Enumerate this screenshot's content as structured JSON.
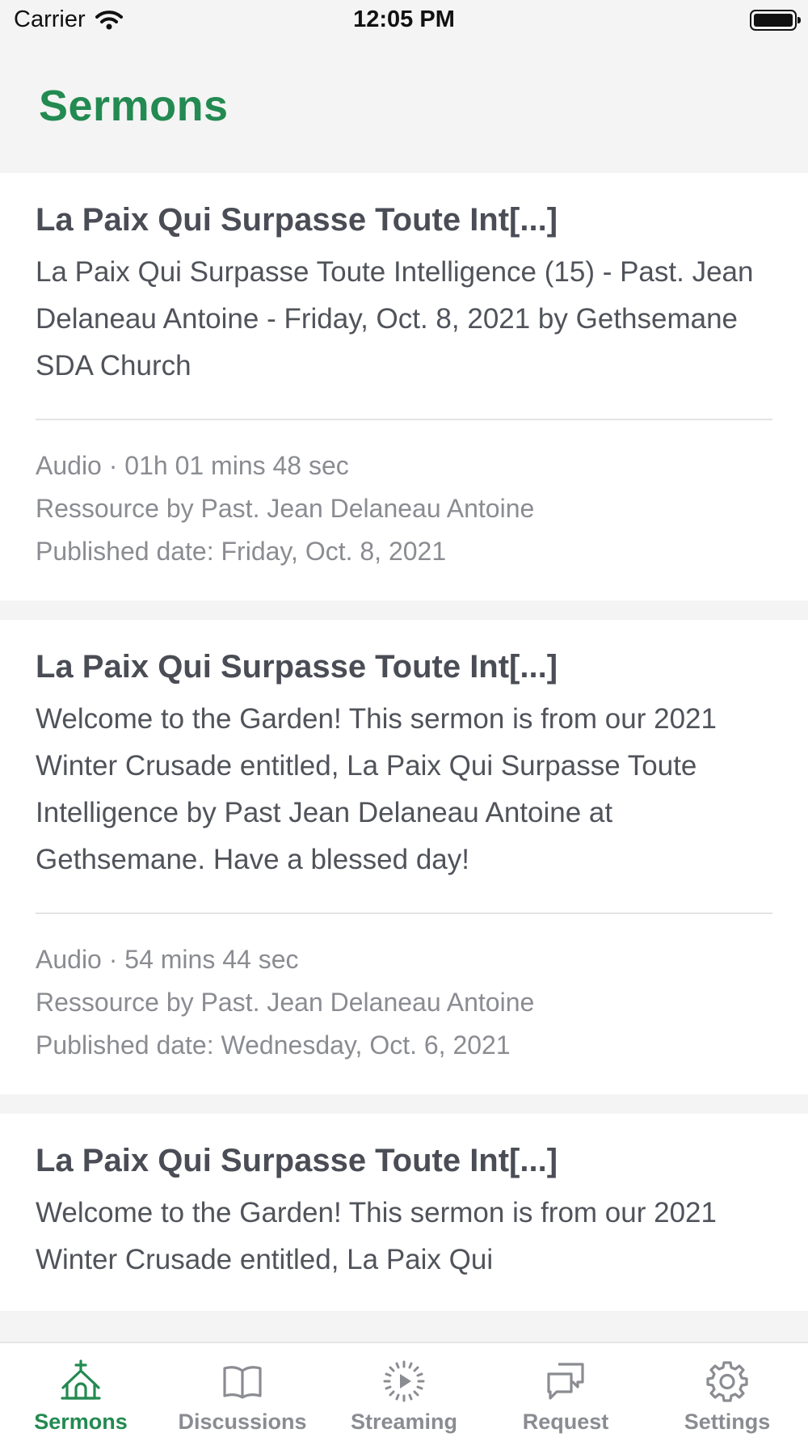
{
  "status_bar": {
    "carrier": "Carrier",
    "time": "12:05 PM"
  },
  "header": {
    "title": "Sermons",
    "accent_color": "#238a51"
  },
  "sermons": [
    {
      "title": "La Paix Qui Surpasse Toute Int[...]",
      "description": "La Paix Qui Surpasse Toute Intelligence (15) - Past. Jean Delaneau Antoine - Friday, Oct. 8, 2021 by Gethsemane SDA Church",
      "type_duration": "Audio · 01h 01 mins 48 sec",
      "resource_by": "Ressource by Past. Jean Delaneau Antoine",
      "published": "Published date: Friday, Oct. 8, 2021"
    },
    {
      "title": "La Paix Qui Surpasse Toute Int[...]",
      "description": "Welcome to the Garden! This sermon is from our 2021 Winter Crusade entitled, La Paix Qui Surpasse Toute Intelligence by Past Jean Delaneau Antoine at Gethsemane. Have a blessed day!",
      "type_duration": "Audio · 54 mins 44 sec",
      "resource_by": "Ressource by Past. Jean Delaneau Antoine",
      "published": "Published date: Wednesday, Oct. 6, 2021"
    },
    {
      "title": "La Paix Qui Surpasse Toute Int[...]",
      "description": "Welcome to the Garden! This sermon is from our 2021 Winter Crusade entitled, La Paix Qui"
    }
  ],
  "tab_bar": {
    "items": [
      {
        "label": "Sermons",
        "icon": "church-icon",
        "active": true
      },
      {
        "label": "Discussions",
        "icon": "book-icon",
        "active": false
      },
      {
        "label": "Streaming",
        "icon": "play-icon",
        "active": false
      },
      {
        "label": "Request",
        "icon": "chat-bubbles-icon",
        "active": false
      },
      {
        "label": "Settings",
        "icon": "gear-icon",
        "active": false
      }
    ]
  }
}
